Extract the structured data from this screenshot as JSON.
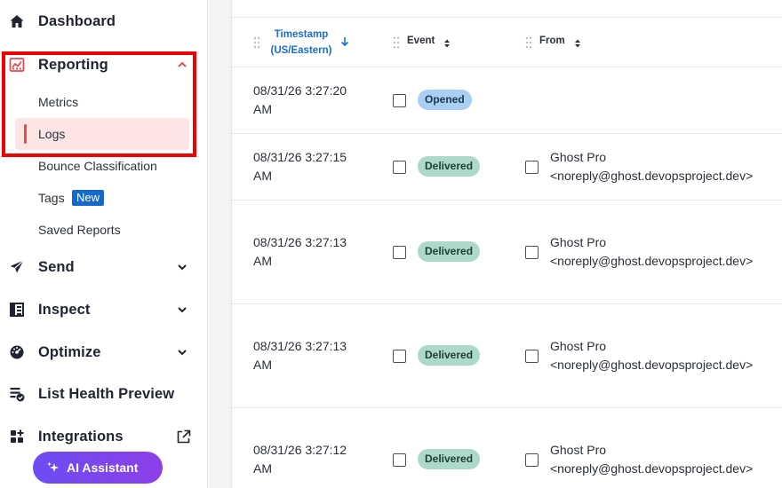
{
  "sidebar": {
    "dashboard": "Dashboard",
    "reporting": "Reporting",
    "reporting_sub": [
      "Metrics",
      "Logs",
      "Bounce Classification",
      "Tags",
      "Saved Reports"
    ],
    "tags_badge": "New",
    "send": "Send",
    "inspect": "Inspect",
    "optimize": "Optimize",
    "list_health": "List Health Preview",
    "integrations": "Integrations",
    "ai_assistant": "AI Assistant"
  },
  "table": {
    "headers": {
      "timestamp_line1": "Timestamp",
      "timestamp_line2": "(US/Eastern)",
      "event": "Event",
      "from": "From"
    },
    "rows": [
      {
        "ts1": "08/31/26 3:27:20",
        "ts2": "AM",
        "event": "Opened",
        "from1": "",
        "from2": ""
      },
      {
        "ts1": "08/31/26 3:27:15",
        "ts2": "AM",
        "event": "Delivered",
        "from1": "Ghost Pro",
        "from2": "<noreply@ghost.devopsproject.dev>"
      },
      {
        "ts1": "08/31/26 3:27:13",
        "ts2": "AM",
        "event": "Delivered",
        "from1": "Ghost Pro",
        "from2": "<noreply@ghost.devopsproject.dev>"
      },
      {
        "ts1": "08/31/26 3:27:13",
        "ts2": "AM",
        "event": "Delivered",
        "from1": "Ghost Pro",
        "from2": "<noreply@ghost.devopsproject.dev>"
      },
      {
        "ts1": "08/31/26 3:27:12",
        "ts2": "AM",
        "event": "Delivered",
        "from1": "Ghost Pro",
        "from2": "<noreply@ghost.devopsproject.dev>"
      }
    ]
  },
  "colors": {
    "accent_red": "#e04e4e",
    "link_blue": "#1a6fc9",
    "opened_pill": "#a9cff4",
    "delivered_pill": "#acd9c8",
    "ai_gradient_start": "#6b4df2",
    "ai_gradient_end": "#8d3fe8"
  },
  "icons": {
    "dashboard": "home-icon",
    "reporting": "chart-icon",
    "send": "paper-plane-icon",
    "inspect": "grid-inspect-icon",
    "optimize": "gauge-icon",
    "list_health": "list-check-icon",
    "integrations": "puzzle-grid-icon",
    "external": "external-link-icon",
    "ai": "sparkle-icon"
  }
}
